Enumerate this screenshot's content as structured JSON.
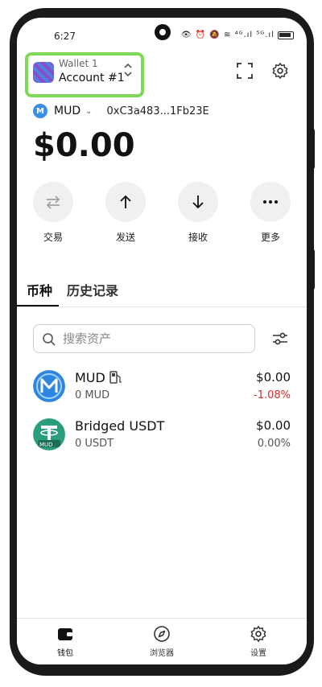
{
  "status_bar": {
    "time": "6:27",
    "icons": "👁 ⏰ 🔕 ≋ ⁴ᴳ.ıl ⁵ᴳ.ıl"
  },
  "header": {
    "wallet_label": "Wallet 1",
    "account_name": "Account #1"
  },
  "network": {
    "name": "MUD",
    "address": "0xC3a483...1Fb23E"
  },
  "balance": "$0.00",
  "actions": [
    {
      "label": "交易",
      "icon": "swap-icon"
    },
    {
      "label": "发送",
      "icon": "arrow-up-icon"
    },
    {
      "label": "接收",
      "icon": "arrow-down-icon"
    },
    {
      "label": "更多",
      "icon": "more-icon"
    }
  ],
  "tabs": {
    "tokens": "币种",
    "history": "历史记录"
  },
  "search": {
    "placeholder": "搜索资产"
  },
  "assets": [
    {
      "name": "MUD",
      "amount": "0 MUD",
      "value": "$0.00",
      "change": "-1.08%",
      "change_color": "#d0312d"
    },
    {
      "name": "Bridged USDT",
      "amount": "0 USDT",
      "value": "$0.00",
      "change": "0.00%",
      "change_color": "#555555",
      "badge": "MUD"
    }
  ],
  "bottom_nav": [
    {
      "label": "钱包",
      "icon": "wallet-icon",
      "active": true
    },
    {
      "label": "浏览器",
      "icon": "compass-icon",
      "active": false
    },
    {
      "label": "设置",
      "icon": "gear-icon",
      "active": false
    }
  ],
  "colors": {
    "highlight": "#7ed957",
    "negative": "#d0312d",
    "accent": "#111111"
  }
}
